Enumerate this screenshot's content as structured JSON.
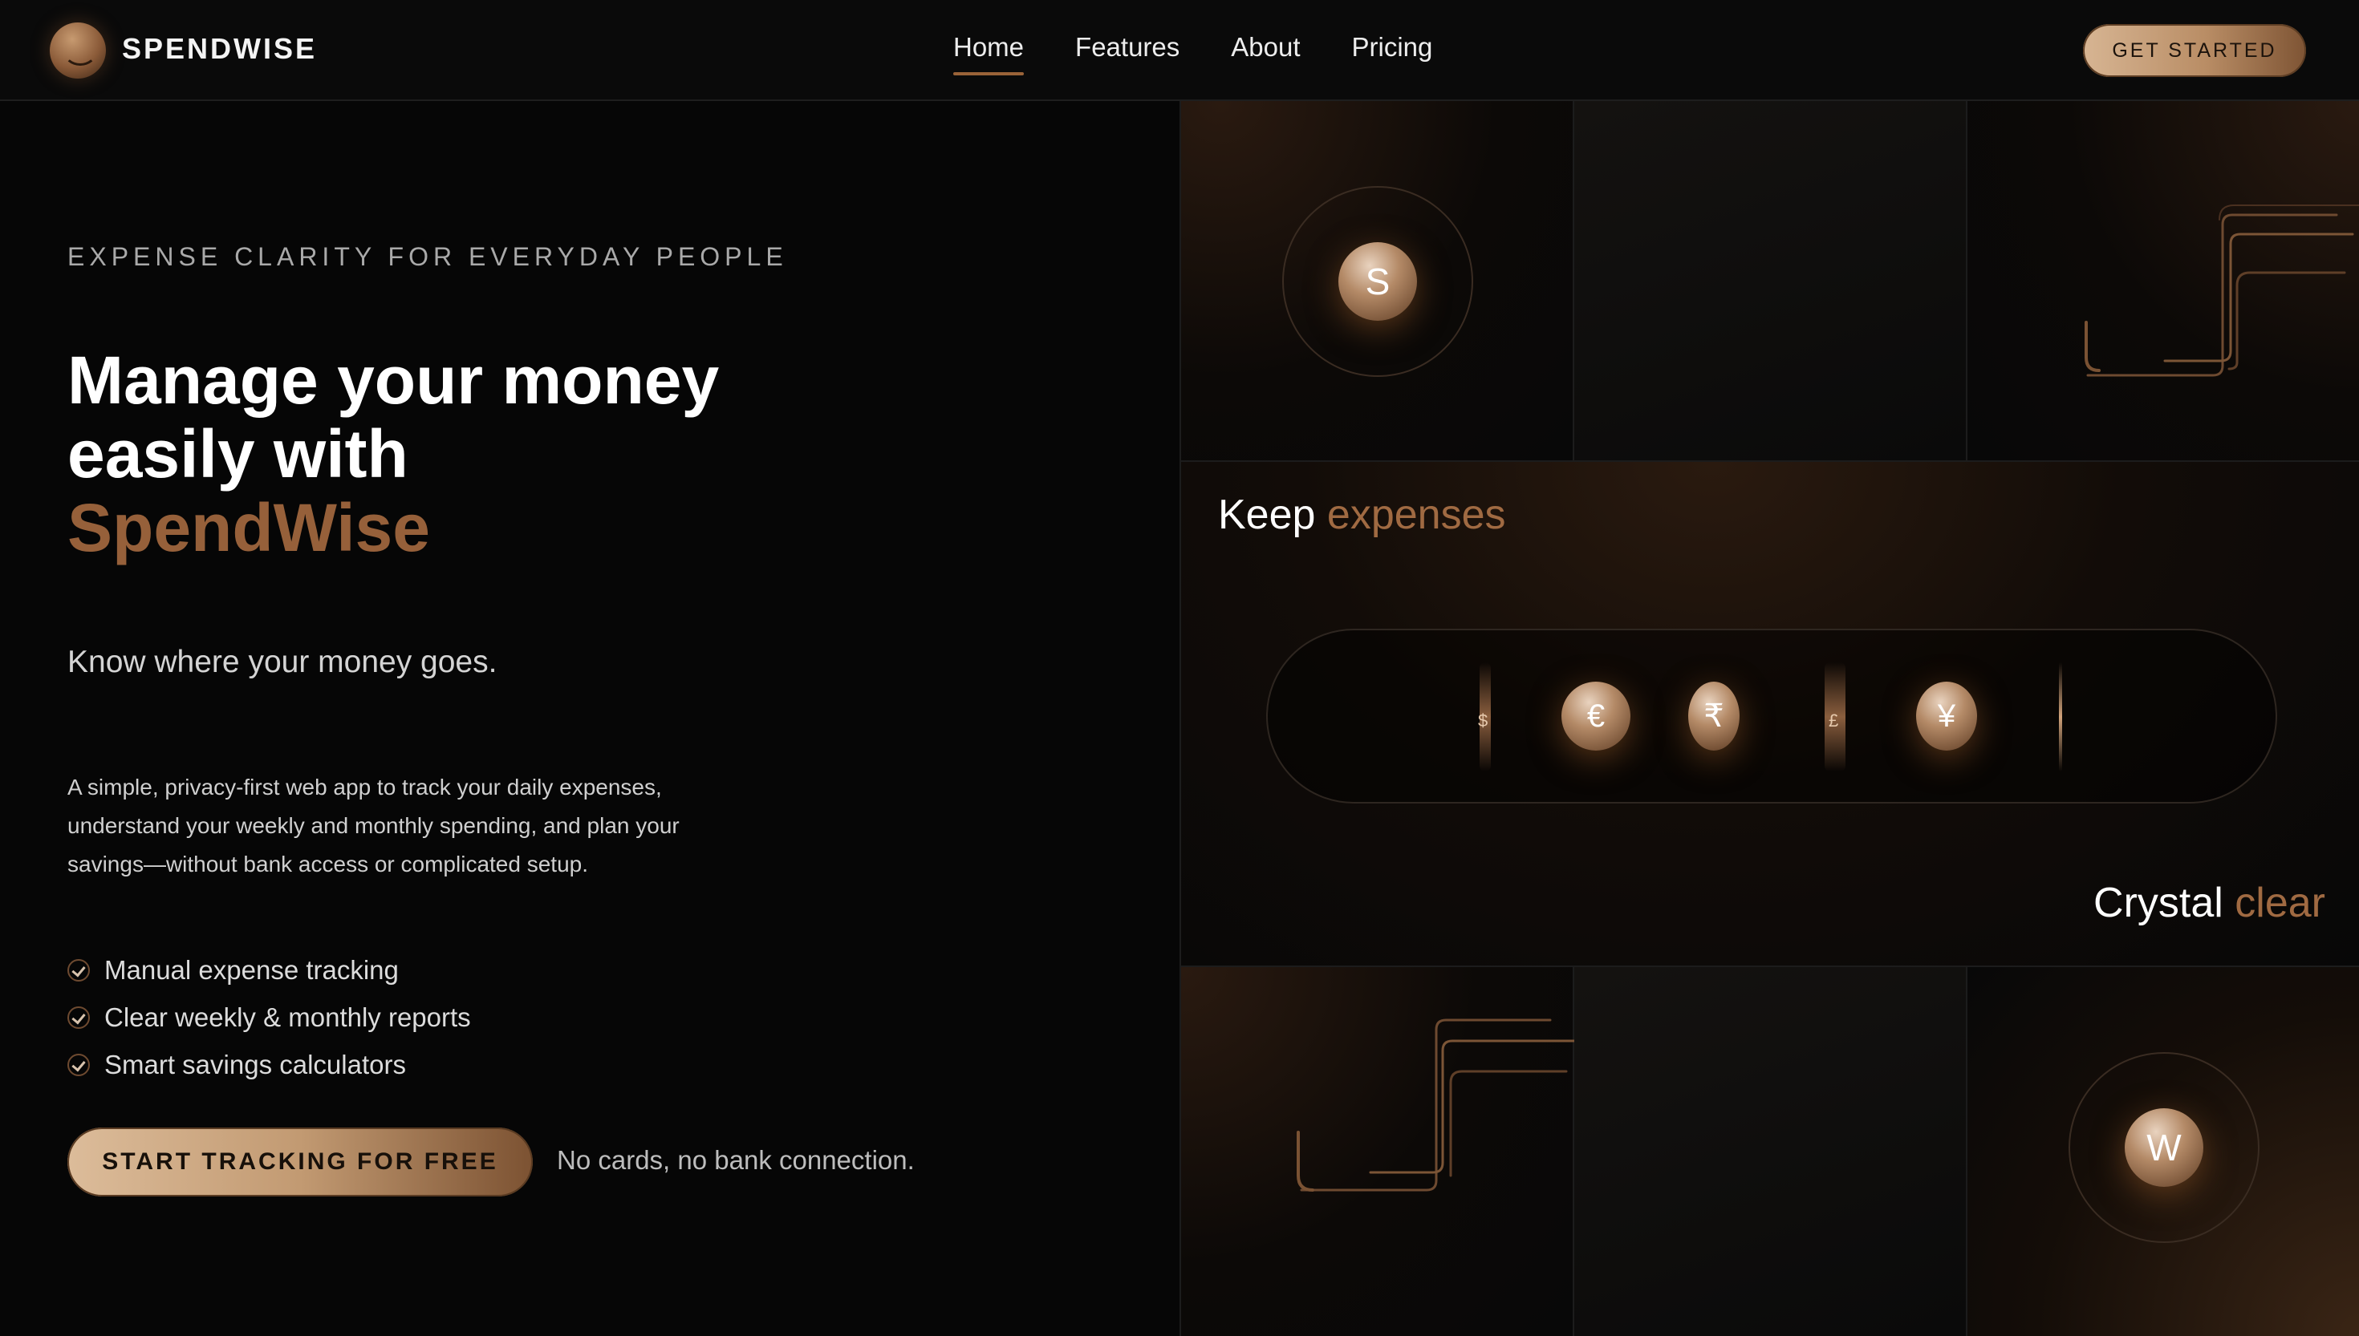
{
  "brand": {
    "name": "SPENDWISE"
  },
  "nav": {
    "links": [
      {
        "label": "Home",
        "active": true
      },
      {
        "label": "Features",
        "active": false
      },
      {
        "label": "About",
        "active": false
      },
      {
        "label": "Pricing",
        "active": false
      }
    ],
    "cta": "GET STARTED"
  },
  "hero": {
    "eyebrow": "EXPENSE CLARITY FOR EVERYDAY PEOPLE",
    "headline_line1": "Manage your money",
    "headline_line2": "easily with",
    "headline_accent": "SpendWise",
    "subhead": "Know where your money goes.",
    "description": "A simple, privacy-first web app to track your daily expenses, understand your weekly and monthly spending, and plan your savings—without bank access or complicated setup.",
    "features": [
      "Manual expense tracking",
      "Clear weekly & monthly reports",
      "Smart savings calculators"
    ],
    "cta": "START TRACKING FOR FREE",
    "cta_note": "No cards, no bank connection."
  },
  "visual": {
    "coin_top": "S",
    "coin_bottom": "W",
    "band_title_plain": "Keep",
    "band_title_accent": "expenses",
    "band_title2_plain": "Crystal",
    "band_title2_accent": "clear",
    "currency_coins": [
      "€",
      "₹",
      "¥"
    ],
    "edge_glyphs": [
      "$",
      "£"
    ]
  },
  "colors": {
    "background": "#060606",
    "accent": "#96603a",
    "gold_light": "#dcbc9a",
    "gold_dark": "#7c5232"
  }
}
